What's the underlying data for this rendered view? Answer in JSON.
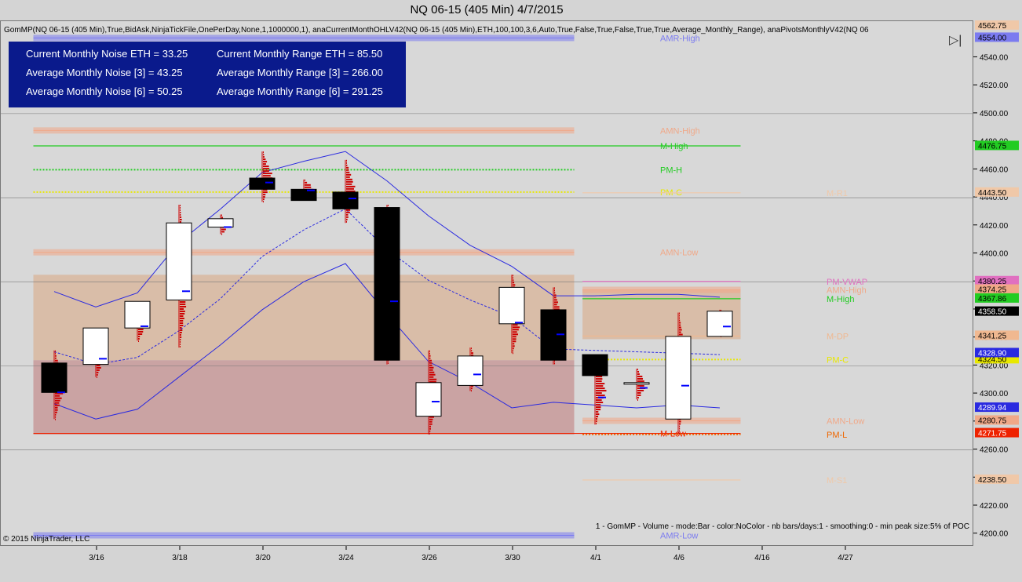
{
  "title": "NQ 06-15 (405 Min)  4/7/2015",
  "indicator_line": "GomMP(NQ 06-15 (405 Min),True,BidAsk,NinjaTickFile,OnePerDay,None,1,1000000,1), anaCurrentMonthOHLV42(NQ 06-15 (405 Min),ETH,100,100,3,6,Auto,True,False,True,False,True,True,Average_Monthly_Range), anaPivotsMonthlyV42(NQ 06",
  "noise_box": {
    "r1c1": "Current Monthly Noise ETH = 33.25",
    "r1c2": "Current Monthly Range ETH = 85.50",
    "r2c1": "Average Monthly Noise [3] = 43.25",
    "r2c2": "Average Monthly Range [3] = 266.00",
    "r3c1": "Average Monthly Noise [6] = 50.25",
    "r3c2": "Average Monthly Range [6] = 291.25"
  },
  "legend_text": "1 - GomMP - Volume - mode:Bar - color:NoColor - nb bars/days:1 - smoothing:0 - min peak size:5% of POC",
  "copyright": "© 2015 NinjaTrader, LLC",
  "colors": {
    "background": "#d8d8d8",
    "up_candle": "#ffffff",
    "down_candle": "#000000",
    "bollinger": "#2a2ae0",
    "profile": "#cc0000",
    "poc": "#0000ff",
    "monthly_high": "#22cc22",
    "monthly_low": "#ee2200",
    "upper_zone": "#d9b9a0",
    "lower_zone": "#c89a9a"
  },
  "chart_data": {
    "type": "candlestick",
    "title": "NQ 06-15 (405 Min)  4/7/2015",
    "ylim": [
      4192,
      4566
    ],
    "y_ticks": [
      4200,
      4220,
      4240,
      4260,
      4280,
      4300,
      4320,
      4340,
      4360,
      4380,
      4400,
      4420,
      4440,
      4460,
      4480,
      4500,
      4520,
      4540
    ],
    "x_ticks": [
      {
        "label": "3/16",
        "index": 1
      },
      {
        "label": "3/18",
        "index": 3
      },
      {
        "label": "3/20",
        "index": 5
      },
      {
        "label": "3/24",
        "index": 7
      },
      {
        "label": "3/26",
        "index": 9
      },
      {
        "label": "3/30",
        "index": 11
      },
      {
        "label": "4/1",
        "index": 13
      },
      {
        "label": "4/6",
        "index": 15
      },
      {
        "label": "4/16",
        "index": 17
      },
      {
        "label": "4/27",
        "index": 19
      }
    ],
    "candles": [
      {
        "i": 0,
        "o": 4322,
        "h": 4331,
        "l": 4282,
        "c": 4301
      },
      {
        "i": 1,
        "o": 4321,
        "h": 4346,
        "l": 4312,
        "c": 4347
      },
      {
        "i": 2,
        "o": 4347,
        "h": 4365,
        "l": 4338,
        "c": 4366
      },
      {
        "i": 3,
        "o": 4367,
        "h": 4435,
        "l": 4333,
        "c": 4422
      },
      {
        "i": 4,
        "o": 4419,
        "h": 4428,
        "l": 4414,
        "c": 4425
      },
      {
        "i": 5,
        "o": 4454,
        "h": 4473,
        "l": 4437,
        "c": 4446
      },
      {
        "i": 6,
        "o": 4446,
        "h": 4453,
        "l": 4441,
        "c": 4438
      },
      {
        "i": 7,
        "o": 4444,
        "h": 4467,
        "l": 4422,
        "c": 4432
      },
      {
        "i": 8,
        "o": 4433,
        "h": 4435,
        "l": 4321,
        "c": 4324
      },
      {
        "i": 9,
        "o": 4284,
        "h": 4331,
        "l": 4271,
        "c": 4308
      },
      {
        "i": 10,
        "o": 4306,
        "h": 4333,
        "l": 4302,
        "c": 4327
      },
      {
        "i": 11,
        "o": 4350,
        "h": 4385,
        "l": 4329,
        "c": 4376
      },
      {
        "i": 12,
        "o": 4360,
        "h": 4376,
        "l": 4321,
        "c": 4324
      },
      {
        "i": 13,
        "o": 4328,
        "h": 4328,
        "l": 4278,
        "c": 4313
      },
      {
        "i": 14,
        "o": 4308,
        "h": 4318,
        "l": 4296,
        "c": 4308
      },
      {
        "i": 15,
        "o": 4282,
        "h": 4358,
        "l": 4272,
        "c": 4341
      },
      {
        "i": 16,
        "o": 4341,
        "h": 4360,
        "l": 4341,
        "c": 4359
      }
    ],
    "bollinger": {
      "upper": [
        [
          0,
          4373
        ],
        [
          1,
          4362
        ],
        [
          2,
          4372
        ],
        [
          3,
          4408
        ],
        [
          4,
          4432
        ],
        [
          5,
          4458
        ],
        [
          6,
          4466
        ],
        [
          7,
          4473
        ],
        [
          8,
          4452
        ],
        [
          9,
          4427
        ],
        [
          10,
          4406
        ],
        [
          11,
          4391
        ],
        [
          12,
          4370
        ],
        [
          13,
          4370
        ],
        [
          14,
          4371
        ],
        [
          15,
          4371
        ],
        [
          16,
          4369
        ]
      ],
      "middle": [
        [
          0,
          4330
        ],
        [
          1,
          4321
        ],
        [
          2,
          4326
        ],
        [
          3,
          4345
        ],
        [
          4,
          4368
        ],
        [
          5,
          4398
        ],
        [
          6,
          4417
        ],
        [
          7,
          4432
        ],
        [
          8,
          4403
        ],
        [
          9,
          4381
        ],
        [
          10,
          4367
        ],
        [
          11,
          4355
        ],
        [
          12,
          4332
        ],
        [
          13,
          4331
        ],
        [
          14,
          4330
        ],
        [
          15,
          4329
        ],
        [
          16,
          4328
        ]
      ],
      "lower": [
        [
          0,
          4293
        ],
        [
          1,
          4282
        ],
        [
          2,
          4289
        ],
        [
          3,
          4312
        ],
        [
          4,
          4335
        ],
        [
          5,
          4360
        ],
        [
          6,
          4380
        ],
        [
          7,
          4393
        ],
        [
          8,
          4357
        ],
        [
          9,
          4323
        ],
        [
          10,
          4308
        ],
        [
          11,
          4290
        ],
        [
          12,
          4294
        ],
        [
          13,
          4292
        ],
        [
          14,
          4290
        ],
        [
          15,
          4292
        ],
        [
          16,
          4290
        ]
      ]
    },
    "zones": [
      {
        "name": "upper",
        "from_index": -0.5,
        "to_index": 12.5,
        "y1": 4324,
        "y2": 4385
      },
      {
        "name": "lower",
        "from_index": -0.5,
        "to_index": 12.5,
        "y1": 4271,
        "y2": 4324
      },
      {
        "name": "upper",
        "from_index": 12.7,
        "to_index": 16.5,
        "y1": 4339,
        "y2": 4374
      }
    ],
    "levels": [
      {
        "label": "AMR-High",
        "value": 4554,
        "color": "#7b7bf0",
        "style": "band",
        "from": -0.5,
        "to": 12.5,
        "tag": ""
      },
      {
        "label": "AMN-High",
        "value": 4488,
        "color": "#f0a888",
        "style": "band",
        "from": -0.5,
        "to": 12.5,
        "tag": ""
      },
      {
        "label": "M-High",
        "value": 4477,
        "color": "#22cc22",
        "style": "solid",
        "from": -0.5,
        "to": 16.5,
        "tag": ""
      },
      {
        "label": "PM-H",
        "value": 4460,
        "color": "#22cc22",
        "style": "dotted",
        "from": -0.5,
        "to": 12.5,
        "tag": ""
      },
      {
        "label": "PM-C",
        "value": 4444,
        "color": "#e8e800",
        "style": "dotted",
        "from": -0.5,
        "to": 12.5,
        "tag": ""
      },
      {
        "label": "M-R1",
        "value": 4443.5,
        "color": "#f0c8a8",
        "style": "solid",
        "from": 12.7,
        "to": 16.5,
        "tag": "4443.50"
      },
      {
        "label": "AMN-Low",
        "value": 4401,
        "color": "#f0a888",
        "style": "band",
        "from": -0.5,
        "to": 12.5,
        "tag": ""
      },
      {
        "label": "PM-VWAP",
        "value": 4380.25,
        "color": "#e070c0",
        "style": "solid",
        "from": 12.7,
        "to": 16.5,
        "tag": "4380.25"
      },
      {
        "label": "AMN-High",
        "value": 4374.25,
        "color": "#f0a888",
        "style": "band",
        "from": 12.7,
        "to": 16.5,
        "tag": "4374.25"
      },
      {
        "label": "M-High",
        "value": 4367.86,
        "color": "#22cc22",
        "style": "solid",
        "from": 12.7,
        "to": 16.5,
        "tag": "4367.86"
      },
      {
        "label": "M-DP",
        "value": 4341.25,
        "color": "#f0b890",
        "style": "solid",
        "from": 12.7,
        "to": 16.5,
        "tag": "4341.25"
      },
      {
        "label": "PM-C",
        "value": 4324.5,
        "color": "#e8e800",
        "style": "dotted",
        "from": 12.7,
        "to": 16.5,
        "tag": "4324.50"
      },
      {
        "label": "",
        "value": 4328.9,
        "color": "#2a2ae0",
        "style": "none",
        "from": 0,
        "to": 0,
        "tag": "4328.90"
      },
      {
        "label": "",
        "value": 4289.94,
        "color": "#2a2ae0",
        "style": "none",
        "from": 0,
        "to": 0,
        "tag": "4289.94"
      },
      {
        "label": "AMN-Low",
        "value": 4280.75,
        "color": "#f0a888",
        "style": "band",
        "from": 12.7,
        "to": 16.5,
        "tag": "4280.75"
      },
      {
        "label": "M-Low",
        "value": 4271.75,
        "color": "#ee2200",
        "style": "solid",
        "from": -0.5,
        "to": 16.5,
        "tag": "4271.75"
      },
      {
        "label": "PM-L",
        "value": 4271,
        "color": "#ee6600",
        "style": "dotted",
        "from": 12.7,
        "to": 16.5,
        "tag": ""
      },
      {
        "label": "M-S1",
        "value": 4238.5,
        "color": "#f0c8a8",
        "style": "solid",
        "from": 12.7,
        "to": 16.5,
        "tag": "4238.50"
      },
      {
        "label": "AMR-Low",
        "value": 4199,
        "color": "#7b7bf0",
        "style": "band",
        "from": -0.5,
        "to": 12.5,
        "tag": ""
      },
      {
        "label": "",
        "value": 4554,
        "color": "#7b7bf0",
        "style": "none",
        "from": 0,
        "to": 0,
        "tag": "4554.00"
      },
      {
        "label": "",
        "value": 4476.75,
        "color": "#22cc22",
        "style": "none",
        "from": 0,
        "to": 0,
        "tag": "4476.75"
      },
      {
        "label": "",
        "value": 4562.75,
        "color": "#f0c8a8",
        "style": "none",
        "from": 0,
        "to": 0,
        "tag": "4562.75"
      }
    ],
    "last_price": {
      "value": 4358.5,
      "tag": "4358.50"
    }
  }
}
